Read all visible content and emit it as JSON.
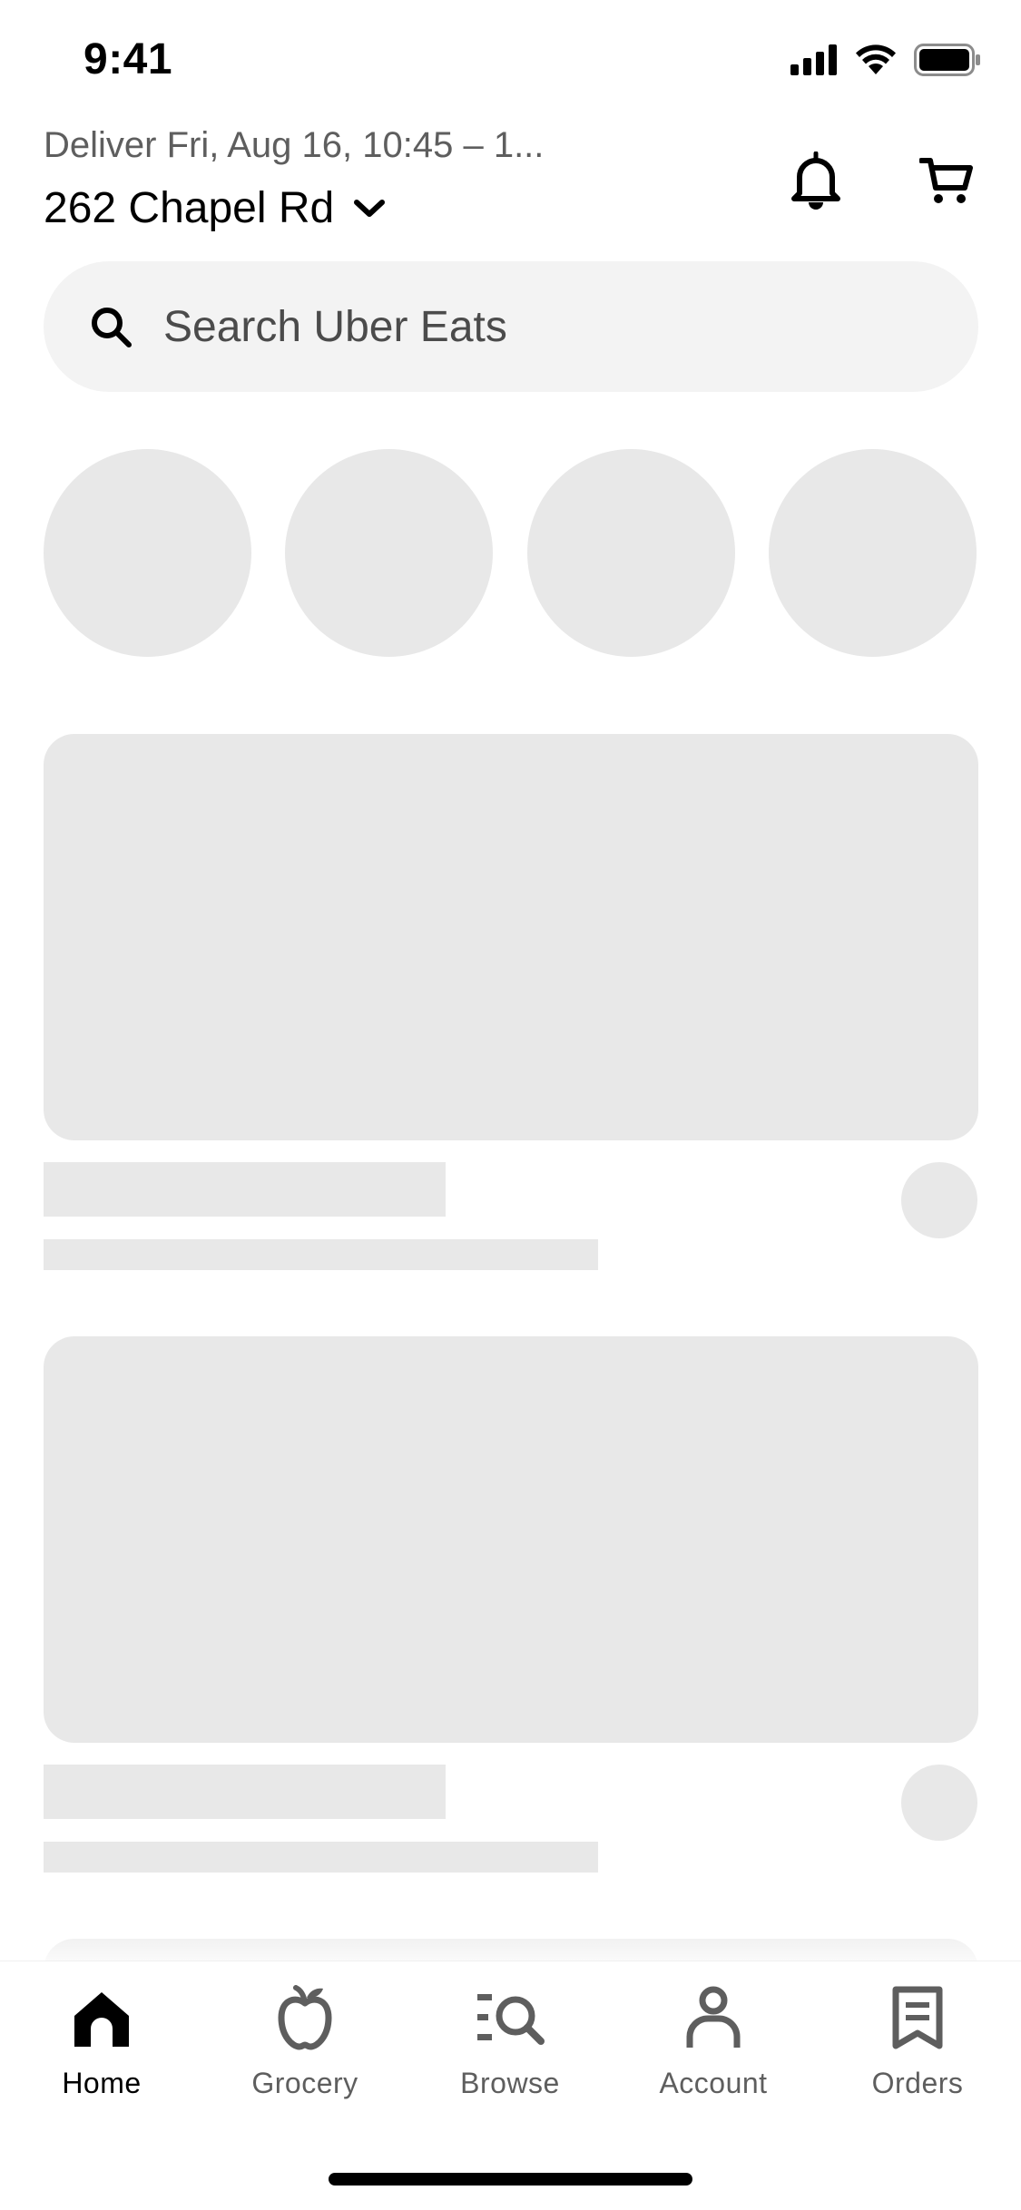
{
  "status_bar": {
    "time": "9:41"
  },
  "header": {
    "deliver_text": "Deliver Fri, Aug 16, 10:45 – 1...",
    "address": "262 Chapel Rd"
  },
  "search": {
    "placeholder": "Search Uber Eats"
  },
  "tabs": [
    {
      "label": "Home",
      "icon": "home-icon",
      "active": true
    },
    {
      "label": "Grocery",
      "icon": "apple-icon",
      "active": false
    },
    {
      "label": "Browse",
      "icon": "browse-search-icon",
      "active": false
    },
    {
      "label": "Account",
      "icon": "person-icon",
      "active": false
    },
    {
      "label": "Orders",
      "icon": "receipt-icon",
      "active": false
    }
  ],
  "colors": {
    "skeleton": "#e8e8e8",
    "search_bg": "#f3f3f3",
    "text_secondary": "#5e5e5e",
    "active_tab": "#000000",
    "inactive_tab": "#5e5e5e"
  }
}
